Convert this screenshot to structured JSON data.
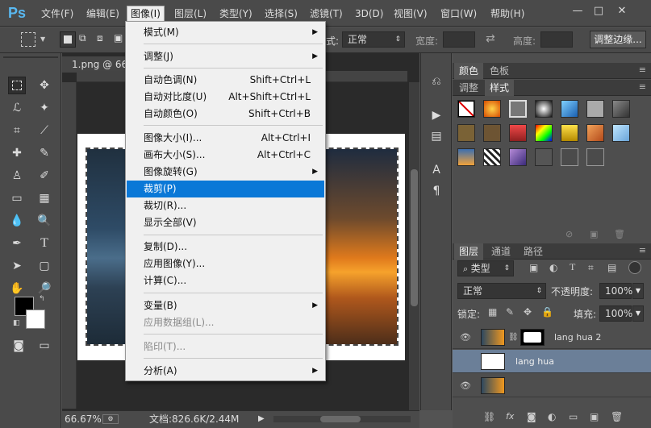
{
  "app": {
    "logo": "Ps"
  },
  "menubar": {
    "items": [
      "文件(F)",
      "编辑(E)",
      "图像(I)",
      "图层(L)",
      "类型(Y)",
      "选择(S)",
      "滤镜(T)",
      "3D(D)",
      "视图(V)",
      "窗口(W)",
      "帮助(H)"
    ],
    "active_index": 2
  },
  "window_controls": {
    "minimize": "—",
    "restore": "□",
    "close": "✕"
  },
  "options_bar": {
    "style_label": "式:",
    "style_value": "正常",
    "width_label": "宽度:",
    "height_label": "高度:",
    "refine_edge_button": "调整边缘..."
  },
  "document": {
    "tab_title": "1.png @ 66.",
    "zoom": "66.67%",
    "doc_info": "文档:826.6K/2.44M"
  },
  "image_menu": {
    "items": [
      {
        "label": "模式(M)",
        "shortcut": "",
        "submenu": true,
        "disabled": false
      },
      {
        "label": "调整(J)",
        "shortcut": "",
        "submenu": true,
        "disabled": false
      },
      {
        "label": "自动色调(N)",
        "shortcut": "Shift+Ctrl+L",
        "submenu": false,
        "disabled": false
      },
      {
        "label": "自动对比度(U)",
        "shortcut": "Alt+Shift+Ctrl+L",
        "submenu": false,
        "disabled": false
      },
      {
        "label": "自动颜色(O)",
        "shortcut": "Shift+Ctrl+B",
        "submenu": false,
        "disabled": false
      },
      {
        "label": "图像大小(I)...",
        "shortcut": "Alt+Ctrl+I",
        "submenu": false,
        "disabled": false
      },
      {
        "label": "画布大小(S)...",
        "shortcut": "Alt+Ctrl+C",
        "submenu": false,
        "disabled": false
      },
      {
        "label": "图像旋转(G)",
        "shortcut": "",
        "submenu": true,
        "disabled": false
      },
      {
        "label": "裁剪(P)",
        "shortcut": "",
        "submenu": false,
        "disabled": false
      },
      {
        "label": "裁切(R)...",
        "shortcut": "",
        "submenu": false,
        "disabled": false
      },
      {
        "label": "显示全部(V)",
        "shortcut": "",
        "submenu": false,
        "disabled": false
      },
      {
        "label": "复制(D)...",
        "shortcut": "",
        "submenu": false,
        "disabled": false
      },
      {
        "label": "应用图像(Y)...",
        "shortcut": "",
        "submenu": false,
        "disabled": false
      },
      {
        "label": "计算(C)...",
        "shortcut": "",
        "submenu": false,
        "disabled": false
      },
      {
        "label": "变量(B)",
        "shortcut": "",
        "submenu": true,
        "disabled": false
      },
      {
        "label": "应用数据组(L)...",
        "shortcut": "",
        "submenu": false,
        "disabled": true
      },
      {
        "label": "陷印(T)...",
        "shortcut": "",
        "submenu": false,
        "disabled": true
      },
      {
        "label": "分析(A)",
        "shortcut": "",
        "submenu": true,
        "disabled": false
      }
    ],
    "highlighted_index": 8
  },
  "color_panel": {
    "tabs": [
      "颜色",
      "色板"
    ],
    "active": 0
  },
  "styles_panel": {
    "tabs": [
      "调整",
      "样式"
    ],
    "active": 1
  },
  "layers_panel": {
    "tabs": [
      "图层",
      "通道",
      "路径"
    ],
    "active": 0,
    "filter_label": "类型",
    "blend_mode": "正常",
    "opacity_label": "不透明度:",
    "opacity_value": "100%",
    "lock_label": "锁定:",
    "fill_label": "填充:",
    "fill_value": "100%",
    "layers": [
      {
        "name": "lang hua 2",
        "selected": false
      },
      {
        "name": "lang hua",
        "selected": true
      },
      {
        "name": "",
        "selected": false
      }
    ]
  },
  "colors": {
    "menu_highlight": "#0a78d7",
    "selected_layer": "#6b7f98",
    "ps_blue": "#59b8f0"
  }
}
